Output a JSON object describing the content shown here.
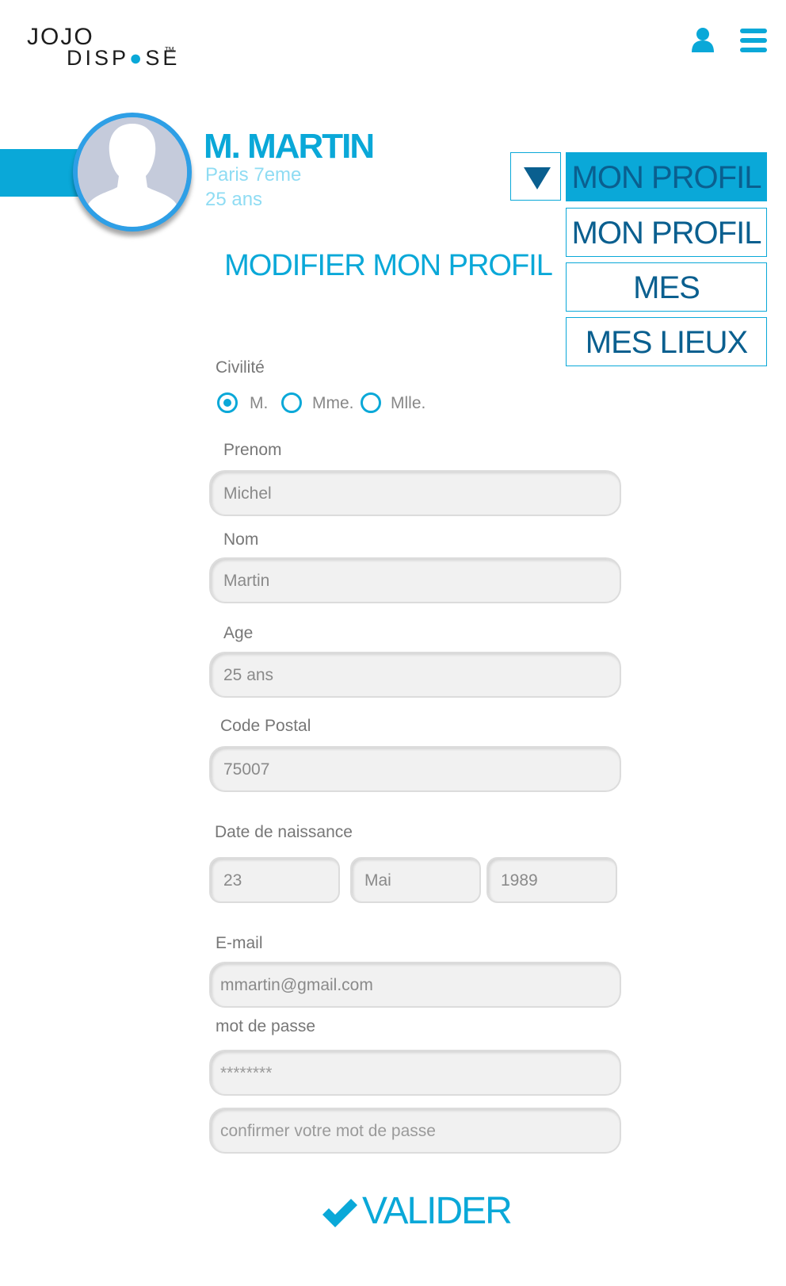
{
  "brand": {
    "line1": "JOJO",
    "line2_a": "DISP",
    "line2_pin": "●",
    "line2_b": "SE",
    "tm": "TM"
  },
  "header": {
    "user_icon": "user-icon",
    "menu_icon": "hamburger-menu-icon"
  },
  "profile": {
    "name": "M. MARTIN",
    "city": "Paris 7eme",
    "age": "25 ans"
  },
  "menu": {
    "active": "MON PROFIL",
    "items": [
      "MON PROFIL",
      "MES PLANNINGS",
      "MES LIEUX"
    ]
  },
  "page_title": "MODIFIER MON PROFIL",
  "form": {
    "civilite_label": "Civilité",
    "civilite_options": [
      "M.",
      "Mme.",
      "Mlle."
    ],
    "civilite_selected": "M.",
    "prenom_label": "Prenom",
    "prenom_value": "Michel",
    "nom_label": "Nom",
    "nom_value": "Martin",
    "age_label": "Age",
    "age_value": "25 ans",
    "cp_label": "Code Postal",
    "cp_value": "75007",
    "dob_label": "Date de naissance",
    "dob_day": "23",
    "dob_month": "Mai",
    "dob_year": "1989",
    "email_label": "E-mail",
    "email_value": "mmartin@gmail.com",
    "password_label": "mot de passe",
    "password_value": "********",
    "confirm_placeholder": "confirmer votre mot de passe"
  },
  "submit_label": "VALIDER",
  "colors": {
    "accent": "#0aa8d8",
    "dark_accent": "#0a5f8f",
    "field_bg": "#f1f1f1"
  }
}
